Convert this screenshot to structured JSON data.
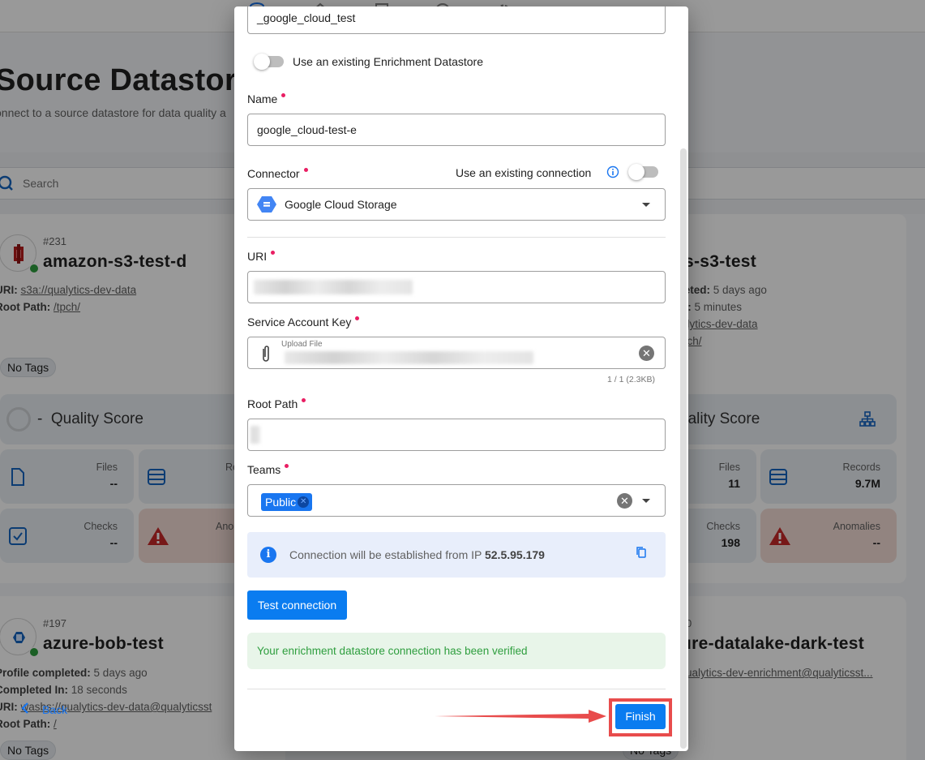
{
  "background": {
    "page_title": "Source Datastore",
    "page_subtitle": "onnect to a source datastore for data quality a",
    "search_placeholder": "Search",
    "cards": [
      {
        "id": "#231",
        "name": "amazon-s3-test-d",
        "lines": [
          {
            "label": "URI:",
            "value": "s3a://qualytics-dev-data",
            "link": true
          },
          {
            "label": "Root Path:",
            "value": "/tpch/",
            "link": true
          }
        ],
        "tags": "No Tags",
        "quality_score_prefix": "-",
        "quality_score_label": "Quality Score",
        "stats": {
          "files_label": "Files",
          "files_value": "--",
          "records_label": "Re",
          "checks_label": "Checks",
          "checks_value": "--",
          "anomalies_label": "Ano"
        }
      },
      {
        "name": "s-s3-test",
        "lines": [
          {
            "label": "leted:",
            "value": "5 days ago",
            "link": false
          },
          {
            "label": "n:",
            "value": "5 minutes",
            "link": false
          },
          {
            "label": "",
            "value": "alytics-dev-data",
            "link": true
          },
          {
            "label": "",
            "value": "pch/",
            "link": true
          }
        ],
        "quality_score_label": "uality Score",
        "stats": {
          "files_label": "Files",
          "files_value": "11",
          "records_label": "Records",
          "records_value": "9.7M",
          "checks_label": "Checks",
          "checks_value": "198",
          "anomalies_label": "Anomalies",
          "anomalies_value": "--"
        }
      },
      {
        "id": "#197",
        "name": "azure-bob-test",
        "lines": [
          {
            "label": "Profile completed:",
            "value": "5 days ago",
            "link": false
          },
          {
            "label": "Completed In:",
            "value": "18 seconds",
            "link": false
          },
          {
            "label": "URI:",
            "value": "wasbs://qualytics-dev-data@qualyticsst",
            "link": true
          },
          {
            "label": "Root Path:",
            "value": "/",
            "link": true
          }
        ],
        "tags": "No Tags"
      },
      {
        "id": "0",
        "name": "ure-datalake-dark-test",
        "lines": [
          {
            "label": "",
            "value": "ualytics-dev-enrichment@qualyticsst...",
            "link": true
          }
        ],
        "tags": "No Tags"
      }
    ]
  },
  "modal": {
    "prefix_value": "_google_cloud_test",
    "use_existing_enrichment_label": "Use an existing Enrichment Datastore",
    "use_existing_enrichment_on": false,
    "name_label": "Name",
    "name_value": "google_cloud-test-e",
    "connector_label": "Connector",
    "use_existing_connection_label": "Use an existing connection",
    "use_existing_connection_on": false,
    "connector_value": "Google Cloud Storage",
    "uri_label": "URI",
    "service_account_key_label": "Service Account Key",
    "upload_file_label": "Upload File",
    "file_count": "1 / 1 (2.3KB)",
    "root_path_label": "Root Path",
    "teams_label": "Teams",
    "teams_selected": [
      "Public"
    ],
    "ip_message_prefix": "Connection will be established from IP",
    "ip_address": "52.5.95.179",
    "test_connection_label": "Test connection",
    "success_message": "Your enrichment datastore connection has been verified",
    "back_label": "Back",
    "finish_label": "Finish"
  },
  "colors": {
    "primary": "#0a7cf0",
    "required": "#e91e63",
    "success_text": "#2e9e3e",
    "annotation": "#e84c4c"
  }
}
